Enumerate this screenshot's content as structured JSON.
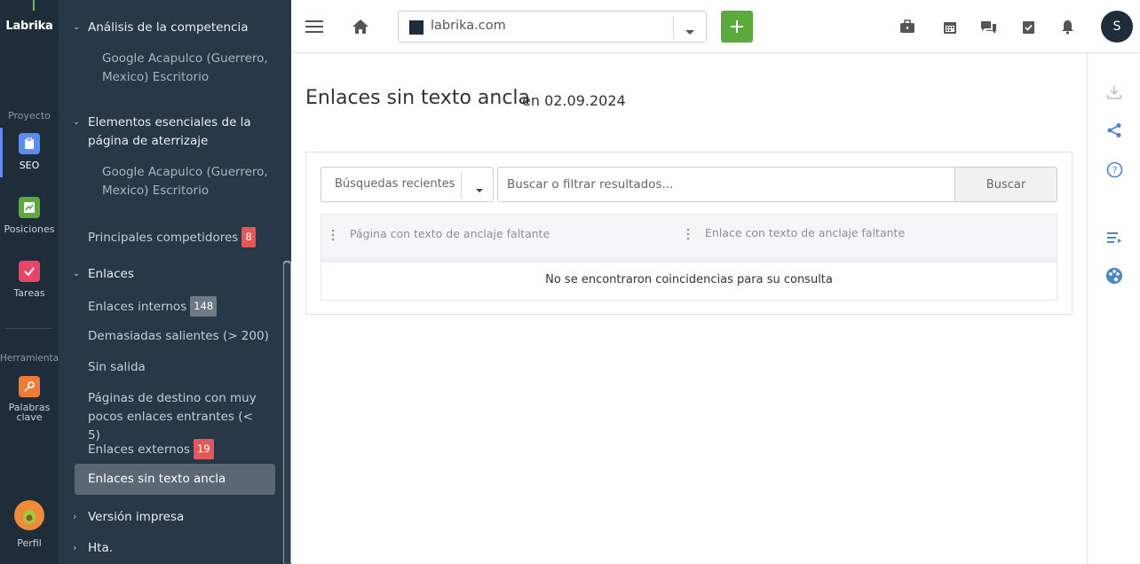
{
  "rail": {
    "logo": "Labrika",
    "section_project": "Proyecto",
    "section_tools": "Herramientas",
    "items": [
      {
        "label": "SEO",
        "icon": "clipboard-icon",
        "color": "#5b8def"
      },
      {
        "label": "Posiciones",
        "icon": "chart-icon",
        "color": "#5aab3c"
      },
      {
        "label": "Tareas",
        "icon": "check-icon",
        "color": "#e8456a"
      },
      {
        "label": "Palabras clave",
        "icon": "key-icon",
        "color": "#ef7b3a"
      }
    ],
    "profile_label": "Perfil"
  },
  "menu": {
    "competencia": "Análisis de la competencia",
    "competencia_sub": "Google Acapulco (Guerrero, Mexico) Escritorio",
    "aterrizaje": "Elementos esenciales de la página de aterrizaje",
    "aterrizaje_sub": "Google Acapulco (Guerrero, Mexico) Escritorio",
    "competidores": "Principales competidores",
    "competidores_badge": "8",
    "enlaces": "Enlaces",
    "internos": "Enlaces internos",
    "internos_badge": "148",
    "demasiadas": "Demasiadas salientes (> 200)",
    "sin_salida": "Sin salida",
    "paginas_destino": "Páginas de destino con muy pocos enlaces entrantes (< 5)",
    "externos": "Enlaces externos",
    "externos_badge": "19",
    "sin_texto": "Enlaces sin texto ancla",
    "version_impresa": "Versión impresa",
    "hta": "Hta."
  },
  "topbar": {
    "domain": "labrika.com",
    "user_initial": "S"
  },
  "main": {
    "title": "Enlaces sin texto ancla",
    "date": "en 02.09.2024",
    "recent_searches": "Búsquedas recientes",
    "search_placeholder": "Buscar o filtrar resultados...",
    "search_button": "Buscar",
    "columns": [
      "Página con texto de anclaje faltante",
      "Enlace con texto de anclaje faltante"
    ],
    "empty_message": "No se encontraron coincidencias para su consulta"
  },
  "colors": {
    "accent_green": "#5aab3c",
    "rail_bg": "#1f2d3a",
    "menu_bg": "#283846",
    "badge_red": "#e05a5a"
  }
}
